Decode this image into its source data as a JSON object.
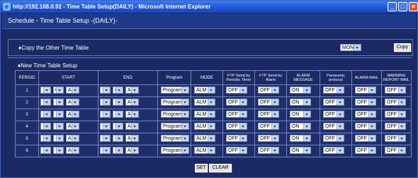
{
  "window": {
    "title": "http://192.168.0.92 - Time Table Setup(DAILY) - Microsoft Internet Explorer"
  },
  "page": {
    "header": "Schedule  - Time Table Setup  -(DAILY)-"
  },
  "copy_section": {
    "label": "♦Copy the Other Time Table",
    "day": "MON",
    "copy_button": "Copy"
  },
  "new_section": {
    "label": "♦New Time Table Setup"
  },
  "table": {
    "headers": [
      "PERIOD",
      "START",
      "END",
      "Program",
      "MODE",
      "FTP Send by Periodic Timer",
      "FTP Send by Alarm",
      "ALARM MESSAGE",
      "Panasonic protocol",
      "ALARM MAIL",
      "WARNING REPORT MAIL"
    ],
    "rows": [
      {
        "period": "1",
        "sh": "12",
        "sm": "00",
        "sap": "AM",
        "eh": "12",
        "em": "00",
        "eap": "AM",
        "program": "Program1",
        "mode": "ALM",
        "ftp_timer": "OFF",
        "ftp_alarm": "OFF",
        "alarm_msg": "ON",
        "protocol": "OFF",
        "alarm_mail": "OFF",
        "warn_mail": "OFF"
      },
      {
        "period": "2",
        "sh": "--",
        "sm": "--",
        "sap": "AM",
        "eh": "--",
        "em": "--",
        "eap": "AM",
        "program": "Program1",
        "mode": "ALM",
        "ftp_timer": "OFF",
        "ftp_alarm": "OFF",
        "alarm_msg": "ON",
        "protocol": "OFF",
        "alarm_mail": "OFF",
        "warn_mail": "OFF"
      },
      {
        "period": "3",
        "sh": "--",
        "sm": "--",
        "sap": "AM",
        "eh": "--",
        "em": "--",
        "eap": "AM",
        "program": "Program1",
        "mode": "ALM",
        "ftp_timer": "OFF",
        "ftp_alarm": "OFF",
        "alarm_msg": "ON",
        "protocol": "OFF",
        "alarm_mail": "OFF",
        "warn_mail": "OFF"
      },
      {
        "period": "4",
        "sh": "--",
        "sm": "--",
        "sap": "AM",
        "eh": "--",
        "em": "--",
        "eap": "AM",
        "program": "Program1",
        "mode": "ALM",
        "ftp_timer": "OFF",
        "ftp_alarm": "OFF",
        "alarm_msg": "ON",
        "protocol": "OFF",
        "alarm_mail": "OFF",
        "warn_mail": "OFF"
      },
      {
        "period": "5",
        "sh": "--",
        "sm": "--",
        "sap": "AM",
        "eh": "--",
        "em": "--",
        "eap": "AM",
        "program": "Program1",
        "mode": "ALM",
        "ftp_timer": "OFF",
        "ftp_alarm": "OFF",
        "alarm_msg": "ON",
        "protocol": "OFF",
        "alarm_mail": "OFF",
        "warn_mail": "OFF"
      },
      {
        "period": "6",
        "sh": "--",
        "sm": "--",
        "sap": "AM",
        "eh": "--",
        "em": "--",
        "eap": "AM",
        "program": "Program1",
        "mode": "ALM",
        "ftp_timer": "OFF",
        "ftp_alarm": "OFF",
        "alarm_msg": "ON",
        "protocol": "OFF",
        "alarm_mail": "OFF",
        "warn_mail": "OFF"
      }
    ]
  },
  "buttons": {
    "set": "SET",
    "clear": "CLEAR"
  }
}
